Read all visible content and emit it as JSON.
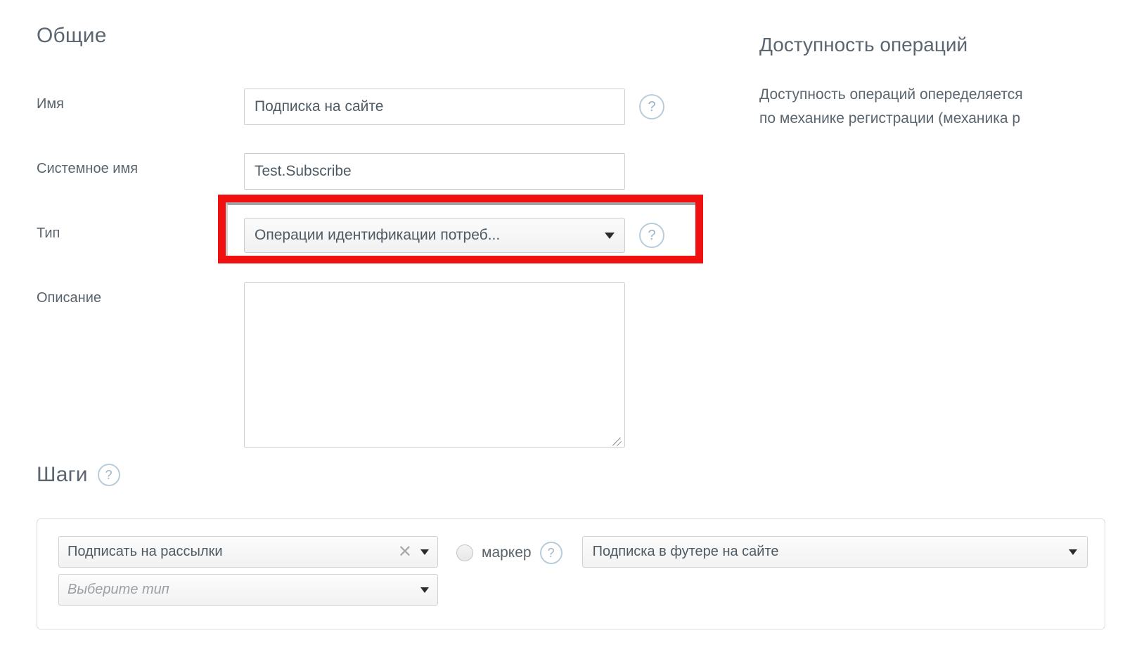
{
  "general": {
    "heading": "Общие",
    "fields": {
      "name": {
        "label": "Имя",
        "value": "Подписка на сайте",
        "placeholder": "",
        "help": "?"
      },
      "system_name": {
        "label": "Системное имя",
        "value": "Test.Subscribe",
        "placeholder": ""
      },
      "type": {
        "label": "Тип",
        "value": "Операции идентификации потреб...",
        "help": "?"
      },
      "description": {
        "label": "Описание",
        "value": "",
        "placeholder": ""
      }
    }
  },
  "availability": {
    "heading": "Доступность операций",
    "body_line_1": "Доступность операций опеределяется",
    "body_line_2": "по механике регистрации (механика р"
  },
  "steps": {
    "heading": "Шаги",
    "heading_help": "?",
    "rows": [
      {
        "action_value": "Подписать на рассылки",
        "action_clear": "✕",
        "type_placeholder": "Выберите тип",
        "marker_label": "маркер",
        "marker_help": "?",
        "target_value": "Подписка в футере на сайте"
      }
    ]
  },
  "icons": {
    "help": "?",
    "clear": "✕"
  },
  "colors": {
    "highlight": "#f01010",
    "heading_text": "#5b6670",
    "label_text": "#58636b",
    "input_border": "#c9cfd3",
    "help_icon_border": "#b9ccd8",
    "panel_border": "#dcdcdc",
    "page_background": "#ffffff"
  }
}
